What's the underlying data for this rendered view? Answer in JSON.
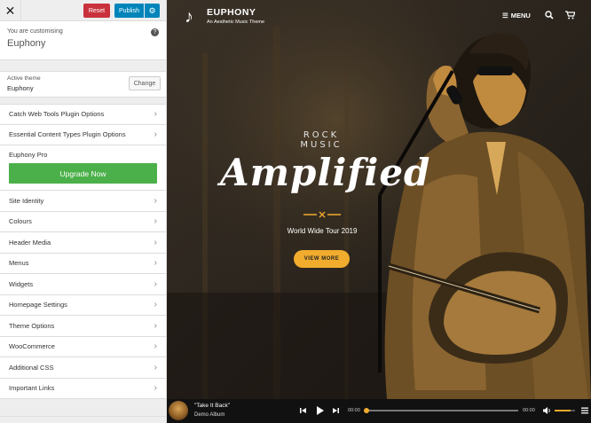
{
  "customizer": {
    "close_glyph": "✕",
    "reset_label": "Reset",
    "publish_label": "Publish",
    "customizing_label": "You are customising",
    "site_name": "Euphony",
    "active_theme_label": "Active theme",
    "active_theme_name": "Euphony",
    "change_label": "Change",
    "sections_top": [
      {
        "label": "Catch Web Tools Plugin Options"
      },
      {
        "label": "Essential Content Types Plugin Options"
      }
    ],
    "pro": {
      "title": "Euphony Pro",
      "button": "Upgrade Now"
    },
    "sections": [
      {
        "label": "Site Identity"
      },
      {
        "label": "Colours"
      },
      {
        "label": "Header Media"
      },
      {
        "label": "Menus"
      },
      {
        "label": "Widgets"
      },
      {
        "label": "Homepage Settings"
      },
      {
        "label": "Theme Options"
      },
      {
        "label": "WooCommerce"
      },
      {
        "label": "Additional CSS"
      },
      {
        "label": "Important Links"
      }
    ],
    "colors": {
      "reset": "#c9323c",
      "publish": "#0085ba",
      "upgrade": "#4bb049"
    }
  },
  "preview": {
    "site_title": "EUPHONY",
    "tagline": "An Aesthetic Music Theme",
    "menu_label": "MENU",
    "hero": {
      "subtitle": "ROCK MUSIC",
      "title": "Amplified",
      "tour": "World Wide Tour 2019",
      "button": "VIEW MORE"
    },
    "player": {
      "track_title": "\"Take It Back\"",
      "album": "Demo Album",
      "current_time": "00:00",
      "total_time": "00:00",
      "volume_fraction": 0.8
    },
    "accent_color": "#f1ac2e"
  }
}
